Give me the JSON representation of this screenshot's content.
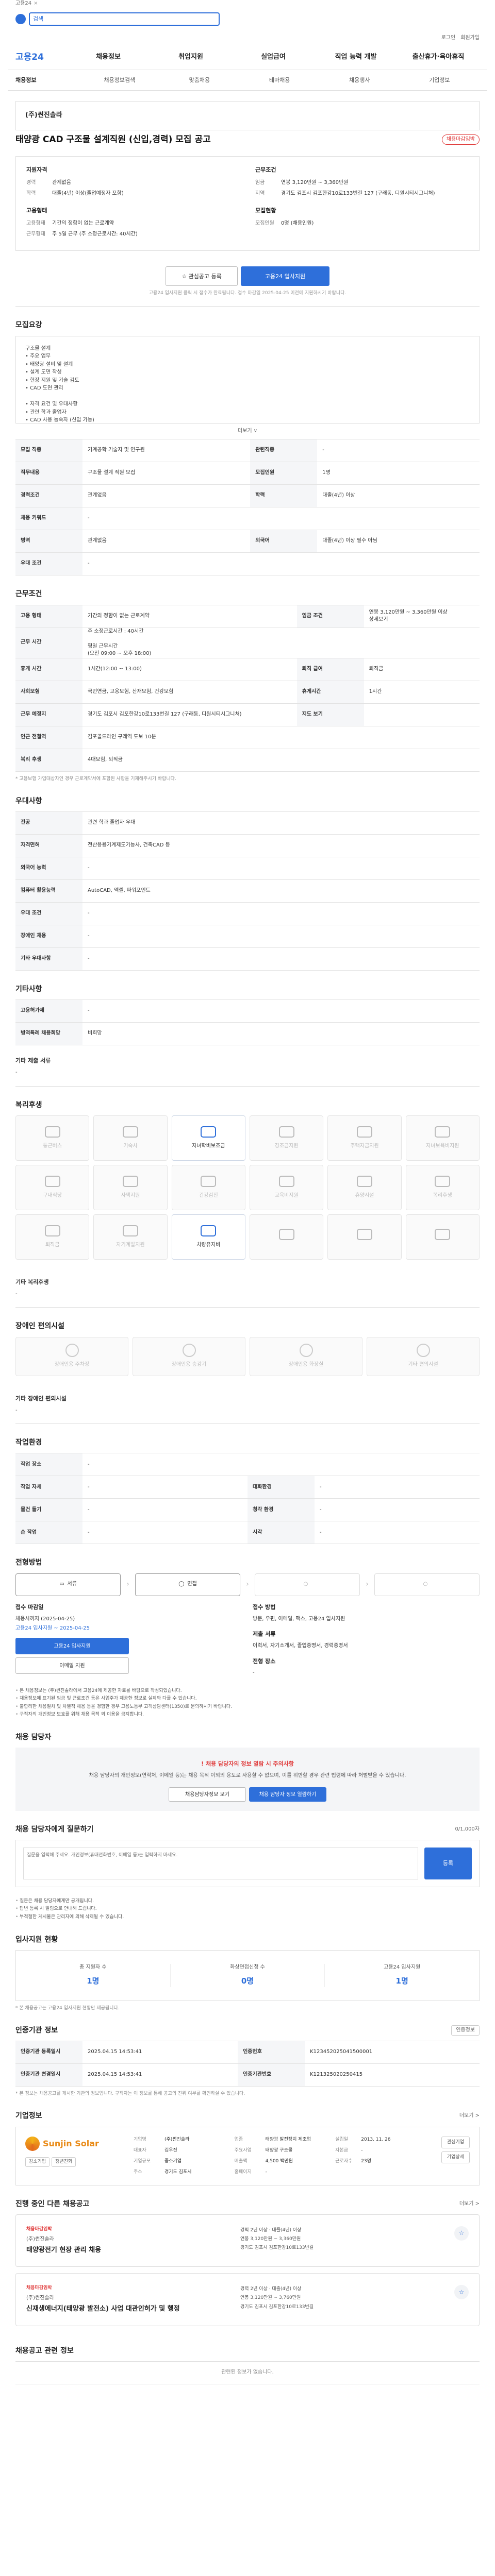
{
  "topbar": {
    "text": "고용24",
    "close": "×"
  },
  "search": {
    "placeholder": "검색"
  },
  "userlinks": [
    "로그인",
    "회원가입"
  ],
  "gnb": {
    "brand": "고용24",
    "items": [
      "채용정보",
      "취업지원",
      "실업급여",
      "직업 능력 개발",
      "출산휴가·육아휴직"
    ]
  },
  "lnb": {
    "items": [
      "채용정보",
      "채용정보검색",
      "맞춤채용",
      "테마채용",
      "채용행사",
      "기업정보"
    ]
  },
  "header": {
    "company": "(주)썬진솔라",
    "title": "태양광 CAD 구조물 설계직원 (신입,경력) 모집 공고",
    "badge": "채용마감임박"
  },
  "summary": {
    "left_title": "지원자격",
    "left": [
      {
        "k": "경력",
        "v": "관계없음"
      },
      {
        "k": "학력",
        "v": "대졸(4년) 이상(졸업예정자 포함)"
      }
    ],
    "left2_title": "고용형태",
    "left2": [
      {
        "k": "고용형태",
        "v": "기간의 정함이 없는 근로계약"
      },
      {
        "k": "근무형태",
        "v": "주 5일 근무 (주 소정근로시간: 40시간)"
      }
    ],
    "right_title": "근무조건",
    "right": [
      {
        "k": "임금",
        "v": "연봉 3,120만원 ~ 3,360만원"
      },
      {
        "k": "지역",
        "v": "경기도 김포시 김포한강10로133번길 127 (구래동, 디원시티시그니처)"
      }
    ],
    "right2_title": "모집현황",
    "right2": [
      {
        "k": "모집인원",
        "v": "0명 (채용인원)"
      }
    ]
  },
  "actions": {
    "scrap": "관심공고 등록",
    "apply": "고용24 입사지원"
  },
  "actions_note": "고용24 입사지원 클릭 시 접수가 완료됩니다. 접수 마감일 2025-04-25 이전에 지원하시기 바랍니다.",
  "job_desc": {
    "title": "모집요강",
    "body": "구조물 설계\n• 주요 업무\n• 태양광 설비 및 설계\n• 설계 도면 작성\n• 현장 지원 및 기술 검토\n• CAD 도면 관리\n\n• 자격 요건 및 우대사항\n• 관련 학과 졸업자\n• CAD 사용 능숙자 (신입 가능)",
    "expand": "더보기 ∨"
  },
  "recruit_table": [
    {
      "k1": "모집 직종",
      "v1": "기계공학 기술자 및 연구원",
      "k2": "관련직종",
      "v2": "-"
    },
    {
      "k1": "직무내용",
      "v1": "구조물 설계 직원 모집",
      "k2": "모집인원",
      "v2": "1명"
    },
    {
      "k1": "경력조건",
      "v1": "관계없음",
      "k2": "학력",
      "v2": "대졸(4년) 이상"
    },
    {
      "k1": "채용 키워드",
      "v1": "-",
      "k2": "",
      "v2": ""
    },
    {
      "k1": "병역",
      "v1": "관계없음",
      "k2": "외국어",
      "v2": "대졸(4년) 이상 필수 아님"
    },
    {
      "k1": "우대 조건",
      "v1": "-",
      "k2": "",
      "v2": ""
    }
  ],
  "conditions": {
    "title": "근무조건",
    "rows": [
      {
        "k1": "고용 형태",
        "v1": "기간의 정함이 없는 근로계약",
        "k2": "임금 조건",
        "v2": "연봉 3,120만원 ~ 3,360만원 이상\n상세보기"
      },
      {
        "k1": "근무 시간",
        "v1": "주 소정근로시간 : 40시간\n\n평일 근무시간\n(오전 09:00 ~ 오후 18:00)",
        "k2": "",
        "v2": ""
      },
      {
        "k1": "휴게 시간",
        "v1": "1시간(12:00 ~ 13:00)",
        "k2": "퇴직 급여",
        "v2": "퇴직금"
      },
      {
        "k1": "사회보험",
        "v1": "국민연금, 고용보험, 산재보험, 건강보험",
        "k2": "휴게시간",
        "v2": "1시간"
      },
      {
        "k1": "근무 예정지",
        "v1": "경기도 김포시 김포한강10로133번길 127 (구래동, 디원시티시그니처)",
        "k2": "지도 보기",
        "v2": ""
      },
      {
        "k1": "인근 전철역",
        "v1": "김포골드라인 구래역 도보 10분",
        "k2": "",
        "v2": ""
      },
      {
        "k1": "복리 후생",
        "v1": "4대보험, 퇴직금",
        "k2": "",
        "v2": ""
      }
    ],
    "note": "* 고용보험 가입대상자인 경우 근로계약서에 포함된 사항을 기재해주시기 바랍니다."
  },
  "extra": {
    "title": "우대사항",
    "rows": [
      {
        "k": "전공",
        "v": "관련 학과 졸업자 우대"
      },
      {
        "k": "자격면허",
        "v": "전산응용기계제도기능사, 건축CAD 등"
      },
      {
        "k": "외국어 능력",
        "v": "-"
      },
      {
        "k": "컴퓨터 활용능력",
        "v": "AutoCAD, 엑셀, 파워포인트"
      },
      {
        "k": "우대 조건",
        "v": "-"
      },
      {
        "k": "장애인 채용",
        "v": "-"
      },
      {
        "k": "기타 우대사항",
        "v": "-"
      }
    ]
  },
  "other": {
    "title": "기타사항",
    "rows": [
      {
        "k": "고용허가제",
        "v": "-"
      },
      {
        "k": "병역특례 채용희망",
        "v": "비희망"
      }
    ],
    "sub_title": "기타 제출 서류",
    "sub_val": "-"
  },
  "welfare": {
    "title": "복리후생",
    "items": [
      {
        "label": "통근버스",
        "on": false
      },
      {
        "label": "기숙사",
        "on": false
      },
      {
        "label": "자녀학비보조금",
        "on": true
      },
      {
        "label": "경조금지원",
        "on": false
      },
      {
        "label": "주택자금지원",
        "on": false
      },
      {
        "label": "자녀보육비지원",
        "on": false
      },
      {
        "label": "구내식당",
        "on": false
      },
      {
        "label": "사택지원",
        "on": false
      },
      {
        "label": "건강검진",
        "on": false
      },
      {
        "label": "교육비지원",
        "on": false
      },
      {
        "label": "휴양시설",
        "on": false
      },
      {
        "label": "복리후생",
        "on": false
      },
      {
        "label": "퇴직금",
        "on": false
      },
      {
        "label": "자기계발지원",
        "on": false
      },
      {
        "label": "차량유지비",
        "on": true
      },
      {
        "label": "",
        "on": false
      },
      {
        "label": "",
        "on": false
      },
      {
        "label": "",
        "on": false
      }
    ],
    "sub_title": "기타 복리후생",
    "sub_val": "-"
  },
  "disability": {
    "title": "장애인 편의시설",
    "items": [
      "장애인용 주차장",
      "장애인용 승강기",
      "장애인용 화장실",
      "기타 편의시설"
    ],
    "sub_title": "기타 장애인 편의시설",
    "sub_val": "-"
  },
  "workenv": {
    "title": "작업환경",
    "rows": [
      {
        "k1": "작업 장소",
        "v1": "-",
        "k2": "",
        "v2": ""
      },
      {
        "k1": "작업 자세",
        "v1": "-",
        "k2": "대화환경",
        "v2": "-"
      },
      {
        "k1": "물건 들기",
        "v1": "-",
        "k2": "청각 환경",
        "v2": "-"
      },
      {
        "k1": "손 작업",
        "v1": "-",
        "k2": "시각",
        "v2": "-"
      }
    ]
  },
  "process": {
    "title": "전형방법",
    "steps": [
      "서류",
      "면접",
      "",
      ""
    ],
    "method_title": "접수 마감일",
    "method_val": "채용시까지 (2025-04-25)",
    "method_sub": "고용24 입사지원 ~ 2025-04-25",
    "apply_title": "접수 방법",
    "apply_val": "방문, 우편, 이메일, 팩스, 고용24 입사지원",
    "apply_btn1": "고용24 입사지원",
    "apply_btn2": "이메일 지원",
    "doc_title": "제출 서류",
    "doc_val": "이력서, 자기소개서, 졸업증명서, 경력증명서",
    "note_title": "전형 장소",
    "note_val": "-"
  },
  "notice_list": [
    "본 채용정보는 (주)썬진솔라에서 고용24에 제공한 자료를 바탕으로 작성되었습니다.",
    "채용정보에 표기된 임금 및 근로조건 등은 사업주가 제공한 정보로 실제와 다를 수 있습니다.",
    "불합리한 채용절차 및 차별적 채용 등을 경험한 경우 고용노동부 고객상담센터(1350)로 문의하시기 바랍니다.",
    "구직자의 개인정보 보호를 위해 채용 목적 외 이용을 금지합니다."
  ],
  "contact": {
    "title": "채용 담당자",
    "banner_title": "! 채용 담당자의 정보 열람 시 주의사항",
    "banner_body": "채용 담당자의 개인정보(연락처, 이메일 등)는 채용 목적 이외의 용도로 사용할 수 없으며, 이를 위반할 경우 관련 법령에 따라 처벌받을 수 있습니다.",
    "btn1": "채용담당자정보 보기",
    "btn2": "채용 담당자 정보 열람하기"
  },
  "qa": {
    "title": "채용 담당자에게 질문하기",
    "count": "0/1,000자",
    "placeholder": "질문을 입력해 주세요. 개인정보(휴대전화번호, 이메일 등)는 입력하지 마세요.",
    "send": "등록",
    "notes": [
      "질문은 채용 담당자에게만 공개됩니다.",
      "답변 등록 시 알림으로 안내해 드립니다.",
      "부적절한 게시물은 관리자에 의해 삭제될 수 있습니다."
    ]
  },
  "stats": {
    "title": "입사지원 현황",
    "items": [
      {
        "l": "총 지원자 수",
        "n": "1명"
      },
      {
        "l": "화상면접신청 수",
        "n": "0명"
      },
      {
        "l": "고용24 입사지원",
        "n": "1명"
      }
    ],
    "note": "* 본 채용공고는 고용24 입사지원 현황만 제공됩니다."
  },
  "info": {
    "title": "인증기관 정보",
    "btn": "인증정보",
    "rows": [
      {
        "k1": "인증기관 등록일시",
        "v1": "2025.04.15 14:53:41",
        "k2": "인증번호",
        "v2": "K123452025041500001"
      },
      {
        "k1": "인증기관 변경일시",
        "v1": "2025.04.15 14:53:41",
        "k2": "인증기관번호",
        "v2": "K121325020250415"
      }
    ],
    "note": "* 본 정보는 채용공고를 게시한 기관의 정보입니다. 구직자는 이 정보를 통해 공고의 진위 여부를 확인하실 수 있습니다."
  },
  "company_info": {
    "title": "기업정보",
    "more": "더보기 >",
    "logo_text": "Sunjin Solar",
    "tags": [
      "강소기업",
      "청년친화"
    ],
    "fields": [
      {
        "k": "기업명",
        "v": "(주)썬진솔라"
      },
      {
        "k": "업종",
        "v": "태양광 발전장치 제조업"
      },
      {
        "k": "설립일",
        "v": "2013. 11. 26"
      },
      {
        "k": "대표자",
        "v": "김우진"
      },
      {
        "k": "주요사업",
        "v": "태양광 구조물"
      },
      {
        "k": "자본금",
        "v": "-"
      },
      {
        "k": "기업규모",
        "v": "중소기업"
      },
      {
        "k": "매출액",
        "v": "4,500 백만원"
      },
      {
        "k": "근로자수",
        "v": "23명"
      },
      {
        "k": "주소",
        "v": "경기도 김포시"
      },
      {
        "k": "홈페이지",
        "v": "-"
      },
      {
        "k": "",
        "v": ""
      }
    ],
    "btns": [
      "관심기업",
      "기업상세"
    ]
  },
  "recommend": {
    "title": "진행 중인 다른 채용공고",
    "more": "더보기 >",
    "jobs": [
      {
        "tag": "채용마감임박",
        "company": "(주)썬진솔라",
        "title": "태양광전기 현장 관리 채용",
        "lines": [
          "경력 2년 이상 · 대졸(4년) 이상",
          "연봉 3,120만원 ~ 3,360만원",
          "경기도 김포시 김포한강10로133번길"
        ]
      },
      {
        "tag": "채용마감임박",
        "company": "(주)썬진솔라",
        "title": "신재생에너지(태양광 발전소) 사업 대관인허가 및 행정",
        "lines": [
          "경력 2년 이상 · 대졸(4년) 이상",
          "연봉 3,120만원 ~ 3,760만원",
          "경기도 김포시 김포한강10로133번길"
        ]
      }
    ]
  },
  "recent": {
    "title": "채용공고 관련 정보",
    "empty": "관련된 정보가 없습니다."
  },
  "colors": {
    "accent": "#2e6fda",
    "alert": "#e03c3c"
  }
}
